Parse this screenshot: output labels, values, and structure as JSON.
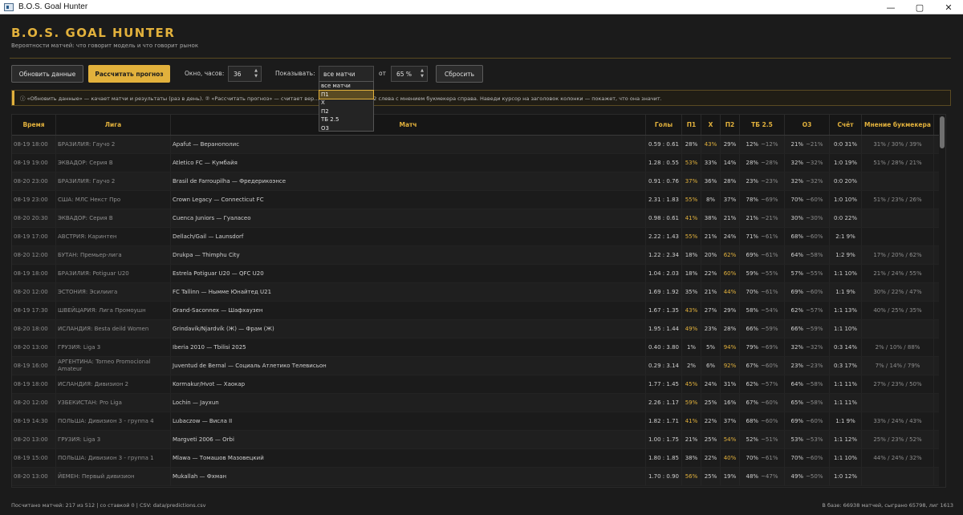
{
  "window": {
    "title": "B.O.S. Goal Hunter",
    "controls": [
      "—",
      "▢",
      "✕"
    ]
  },
  "header": {
    "brand": "B.O.S. GOAL HUNTER",
    "subtitle": "Вероятности матчей: что говорит модель и что говорит рынок"
  },
  "toolbar": {
    "refresh_label": "Обновить данные",
    "compute_label": "Рассчитать прогноз",
    "window_label": "Окно, часов:",
    "window_value": "36",
    "show_label": "Показывать:",
    "show_value": "все матчи",
    "from_label": "от",
    "threshold_value": "65 %",
    "reset_label": "Сбросить"
  },
  "dropdown": {
    "options": [
      "все матчи",
      "П1",
      "X",
      "П2",
      "ТБ 2.5",
      "О3"
    ],
    "highlighted_index": 1
  },
  "info": {
    "text": "ⓘ «Обновить данные» — качает матчи и результаты (раз в день).  ② «Рассчитать прогноз» — считает вер… равнивай П1 / X / П2 слева с мнением букмекера справа. Наведи курсор на заголовок колонки — покажет, что она значит."
  },
  "table": {
    "headers": [
      "Время",
      "Лига",
      "Матч",
      "Голы",
      "П1",
      "X",
      "П2",
      "ТБ 2.5",
      "О3",
      "Счёт",
      "Мнение букмекера"
    ],
    "rows": [
      {
        "time": "08-19 18:00",
        "league": "БРАЗИЛИЯ: Гаучо 2",
        "match": "Apafut — Веранополис",
        "goals": "0.59 : 0.61",
        "p1": "28%",
        "x": "43%",
        "p2": "29%",
        "tb": "12%",
        "tb_m": "~12%",
        "o3": "21%",
        "o3_m": "~21%",
        "score": "0:0 31%",
        "book": "31% / 30% / 39%",
        "hi": "x"
      },
      {
        "time": "08-19 19:00",
        "league": "ЭКВАДОР: Серия B",
        "match": "Atletico FC — Кумбайя",
        "goals": "1.28 : 0.55",
        "p1": "53%",
        "x": "33%",
        "p2": "14%",
        "tb": "28%",
        "tb_m": "~28%",
        "o3": "32%",
        "o3_m": "~32%",
        "score": "1:0 19%",
        "book": "51% / 28% / 21%",
        "hi": "p1"
      },
      {
        "time": "08-20 23:00",
        "league": "БРАЗИЛИЯ: Гаучо 2",
        "match": "Brasil de Farroupilha — Фредерикоэнсе",
        "goals": "0.91 : 0.76",
        "p1": "37%",
        "x": "36%",
        "p2": "28%",
        "tb": "23%",
        "tb_m": "~23%",
        "o3": "32%",
        "o3_m": "~32%",
        "score": "0:0 20%",
        "book": "",
        "hi": "p1"
      },
      {
        "time": "08-19 23:00",
        "league": "США: МЛС Некст Про",
        "match": "Crown Legacy — Connecticut FC",
        "goals": "2.31 : 1.83",
        "p1": "55%",
        "x": "8%",
        "p2": "37%",
        "tb": "78%",
        "tb_m": "~69%",
        "o3": "70%",
        "o3_m": "~60%",
        "score": "1:0 10%",
        "book": "51% / 23% / 26%",
        "hi": "p1"
      },
      {
        "time": "08-20 20:30",
        "league": "ЭКВАДОР: Серия B",
        "match": "Cuenca Juniors — Гуаласео",
        "goals": "0.98 : 0.61",
        "p1": "41%",
        "x": "38%",
        "p2": "21%",
        "tb": "21%",
        "tb_m": "~21%",
        "o3": "30%",
        "o3_m": "~30%",
        "score": "0:0 22%",
        "book": "",
        "hi": "p1"
      },
      {
        "time": "08-19 17:00",
        "league": "АВСТРИЯ: Каринтен",
        "match": "Dellach/Gail — Launsdorf",
        "goals": "2.22 : 1.43",
        "p1": "55%",
        "x": "21%",
        "p2": "24%",
        "tb": "71%",
        "tb_m": "~61%",
        "o3": "68%",
        "o3_m": "~60%",
        "score": "2:1 9%",
        "book": "",
        "hi": "p1"
      },
      {
        "time": "08-20 12:00",
        "league": "БУТАН: Премьер-лига",
        "match": "Drukpa — Thimphu City",
        "goals": "1.22 : 2.34",
        "p1": "18%",
        "x": "20%",
        "p2": "62%",
        "tb": "69%",
        "tb_m": "~61%",
        "o3": "64%",
        "o3_m": "~58%",
        "score": "1:2 9%",
        "book": "17% / 20% / 62%",
        "hi": "p2"
      },
      {
        "time": "08-19 18:00",
        "league": "БРАЗИЛИЯ: Potiguar U20",
        "match": "Estrela Potiguar U20 — QFC U20",
        "goals": "1.04 : 2.03",
        "p1": "18%",
        "x": "22%",
        "p2": "60%",
        "tb": "59%",
        "tb_m": "~55%",
        "o3": "57%",
        "o3_m": "~55%",
        "score": "1:1 10%",
        "book": "21% / 24% / 55%",
        "hi": "p2"
      },
      {
        "time": "08-20 12:00",
        "league": "ЭСТОНИЯ: Эсилиига",
        "match": "FC Tallinn — Нымме Юнайтед U21",
        "goals": "1.69 : 1.92",
        "p1": "35%",
        "x": "21%",
        "p2": "44%",
        "tb": "70%",
        "tb_m": "~61%",
        "o3": "69%",
        "o3_m": "~60%",
        "score": "1:1 9%",
        "book": "30% / 22% / 47%",
        "hi": "p2"
      },
      {
        "time": "08-19 17:30",
        "league": "ШВЕЙЦАРИЯ: Лига Промоушн",
        "match": "Grand-Saconnex — Шафхаузен",
        "goals": "1.67 : 1.35",
        "p1": "43%",
        "x": "27%",
        "p2": "29%",
        "tb": "58%",
        "tb_m": "~54%",
        "o3": "62%",
        "o3_m": "~57%",
        "score": "1:1 13%",
        "book": "40% / 25% / 35%",
        "hi": "p1"
      },
      {
        "time": "08-20 18:00",
        "league": "ИСЛАНДИЯ: Besta deild Women",
        "match": "Grindavík/Njardvík (Ж) — Фрам (Ж)",
        "goals": "1.95 : 1.44",
        "p1": "49%",
        "x": "23%",
        "p2": "28%",
        "tb": "66%",
        "tb_m": "~59%",
        "o3": "66%",
        "o3_m": "~59%",
        "score": "1:1 10%",
        "book": "",
        "hi": "p1"
      },
      {
        "time": "08-20 13:00",
        "league": "ГРУЗИЯ: Liga 3",
        "match": "Iberia 2010 — Tbilisi 2025",
        "goals": "0.40 : 3.80",
        "p1": "1%",
        "x": "5%",
        "p2": "94%",
        "tb": "79%",
        "tb_m": "~69%",
        "o3": "32%",
        "o3_m": "~32%",
        "score": "0:3 14%",
        "book": "2% / 10% / 88%",
        "hi": "p2"
      },
      {
        "time": "08-19 16:00",
        "league": "АРГЕНТИНА: Torneo Promocional Amateur",
        "match": "Juventud de Bernal — Социаль Атлетико Телевисьон",
        "goals": "0.29 : 3.14",
        "p1": "2%",
        "x": "6%",
        "p2": "92%",
        "tb": "67%",
        "tb_m": "~60%",
        "o3": "23%",
        "o3_m": "~23%",
        "score": "0:3 17%",
        "book": "7% / 14% / 79%",
        "hi": "p2"
      },
      {
        "time": "08-19 18:00",
        "league": "ИСЛАНДИЯ: Дивизион 2",
        "match": "Kormakur/Hvot — Хаокар",
        "goals": "1.77 : 1.45",
        "p1": "45%",
        "x": "24%",
        "p2": "31%",
        "tb": "62%",
        "tb_m": "~57%",
        "o3": "64%",
        "o3_m": "~58%",
        "score": "1:1 11%",
        "book": "27% / 23% / 50%",
        "hi": "p1"
      },
      {
        "time": "08-20 12:00",
        "league": "УЗБЕКИСТАН: Pro Liga",
        "match": "Lochin — Jayxun",
        "goals": "2.26 : 1.17",
        "p1": "59%",
        "x": "25%",
        "p2": "16%",
        "tb": "67%",
        "tb_m": "~60%",
        "o3": "65%",
        "o3_m": "~58%",
        "score": "1:1 11%",
        "book": "",
        "hi": "p1"
      },
      {
        "time": "08-19 14:30",
        "league": "ПОЛЬША: Дивизион 3 - группа 4",
        "match": "Lubaczow — Висла II",
        "goals": "1.82 : 1.71",
        "p1": "41%",
        "x": "22%",
        "p2": "37%",
        "tb": "68%",
        "tb_m": "~60%",
        "o3": "69%",
        "o3_m": "~60%",
        "score": "1:1 9%",
        "book": "33% / 24% / 43%",
        "hi": "p1"
      },
      {
        "time": "08-20 13:00",
        "league": "ГРУЗИЯ: Liga 3",
        "match": "Margveti 2006 — Orbi",
        "goals": "1.00 : 1.75",
        "p1": "21%",
        "x": "25%",
        "p2": "54%",
        "tb": "52%",
        "tb_m": "~51%",
        "o3": "53%",
        "o3_m": "~53%",
        "score": "1:1 12%",
        "book": "25% / 23% / 52%",
        "hi": "p2"
      },
      {
        "time": "08-19 15:00",
        "league": "ПОЛЬША: Дивизион 3 - группа 1",
        "match": "Mlawa — Томашов Мазовецкий",
        "goals": "1.80 : 1.85",
        "p1": "38%",
        "x": "22%",
        "p2": "40%",
        "tb": "70%",
        "tb_m": "~61%",
        "o3": "70%",
        "o3_m": "~60%",
        "score": "1:1 10%",
        "book": "44% / 24% / 32%",
        "hi": "p2"
      },
      {
        "time": "08-20 13:00",
        "league": "ЙЕМЕН: Первый дивизион",
        "match": "Mukallah — Фхман",
        "goals": "1.70 : 0.90",
        "p1": "56%",
        "x": "25%",
        "p2": "19%",
        "tb": "48%",
        "tb_m": "~47%",
        "o3": "49%",
        "o3_m": "~50%",
        "score": "1:0 12%",
        "book": "",
        "hi": "p1"
      }
    ]
  },
  "status": {
    "left": "Посчитано матчей: 217 из 512 | со ставкой 0 | CSV: data/predictions.csv",
    "right": "В базе: 66938 матчей, сыграно 65798, лиг 1613"
  },
  "colors": {
    "accent": "#e2b13c",
    "background": "#1b1b1b"
  }
}
